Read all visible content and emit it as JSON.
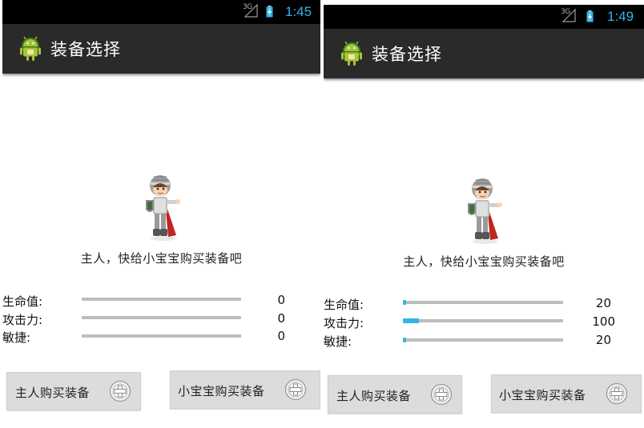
{
  "screens": [
    {
      "status": {
        "network": "3G",
        "time": "1:45"
      },
      "actionbar": {
        "title": "装备选择",
        "icon": "android-robot-icon"
      },
      "prompt": "主人，快给小宝宝购买装备吧",
      "stats": [
        {
          "label": "生命值:",
          "value": "0",
          "level": 0
        },
        {
          "label": "攻击力:",
          "value": "0",
          "level": 0
        },
        {
          "label": "敏捷:",
          "value": "0",
          "level": 0
        }
      ],
      "buttons": {
        "master": "主人购买装备",
        "baby": "小宝宝购买装备"
      }
    },
    {
      "status": {
        "network": "3G",
        "time": "1:49"
      },
      "actionbar": {
        "title": "装备选择",
        "icon": "android-robot-icon"
      },
      "prompt": "主人，快给小宝宝购买装备吧",
      "stats": [
        {
          "label": "生命值:",
          "value": "20",
          "level": 0.02
        },
        {
          "label": "攻击力:",
          "value": "100",
          "level": 0.1
        },
        {
          "label": "敏捷:",
          "value": "20",
          "level": 0.02
        }
      ],
      "buttons": {
        "master": "主人购买装备",
        "baby": "小宝宝购买装备"
      }
    }
  ],
  "colors": {
    "accent": "#33b5e5",
    "actionbar": "#2a2a2a",
    "statusbar": "#000000",
    "button": "#dcdcdc",
    "track": "#bdbdbd"
  }
}
